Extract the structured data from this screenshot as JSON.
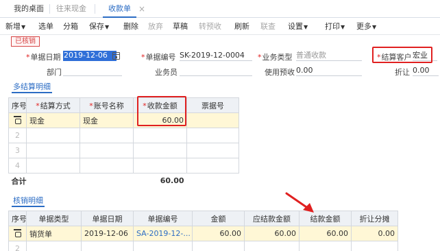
{
  "tabs": [
    {
      "label": "我的桌面"
    },
    {
      "label": "往来现金"
    },
    {
      "label": "收款单"
    }
  ],
  "tab_close_glyph": "×",
  "toolbar": {
    "new": "新增",
    "select_doc": "选单",
    "split": "分箱",
    "save": "保存",
    "delete": "删除",
    "abandon": "放弃",
    "draft": "草稿",
    "to_prepay": "转预收",
    "refresh": "刷新",
    "audit": "联查",
    "settings": "设置",
    "print": "打印",
    "more": "更多"
  },
  "status_badge": "已核销",
  "form": {
    "doc_date_label": "单据日期",
    "doc_date": "2019-12-06",
    "doc_no_label": "单据编号",
    "doc_no": "SK-2019-12-0004",
    "biz_type_label": "业务类型",
    "biz_type": "普通收款",
    "customer_label": "结算客户",
    "customer": "宏业",
    "dept_label": "部门",
    "dept": "",
    "staff_label": "业务员",
    "staff": "",
    "use_prepay_label": "使用预收",
    "use_prepay": "0.00",
    "discount_label": "折让",
    "discount": "0.00"
  },
  "settle_section": {
    "title": "多结算明细",
    "headers": [
      "序号",
      "结算方式",
      "账号名称",
      "收款金额",
      "票据号"
    ],
    "rows": [
      {
        "method": "现金",
        "account": "现金",
        "amount": "60.00",
        "bill_no": ""
      }
    ],
    "empty_rows": [
      "2",
      "3",
      "4"
    ],
    "total_label": "合计",
    "total_amount": "60.00"
  },
  "writeoff_section": {
    "title": "核销明细",
    "headers": [
      "序号",
      "单据类型",
      "单据日期",
      "单据编号",
      "金额",
      "应结款金额",
      "结款金额",
      "折让分摊"
    ],
    "rows": [
      {
        "type": "销货单",
        "date": "2019-12-06",
        "doc_no": "SA-2019-12-...",
        "amount": "60.00",
        "due": "60.00",
        "paid": "60.00",
        "discount_share": "0.00"
      }
    ],
    "empty_rows": [
      "2"
    ]
  },
  "accent_color": "#2b6cc4",
  "highlight_color": "#e02020"
}
